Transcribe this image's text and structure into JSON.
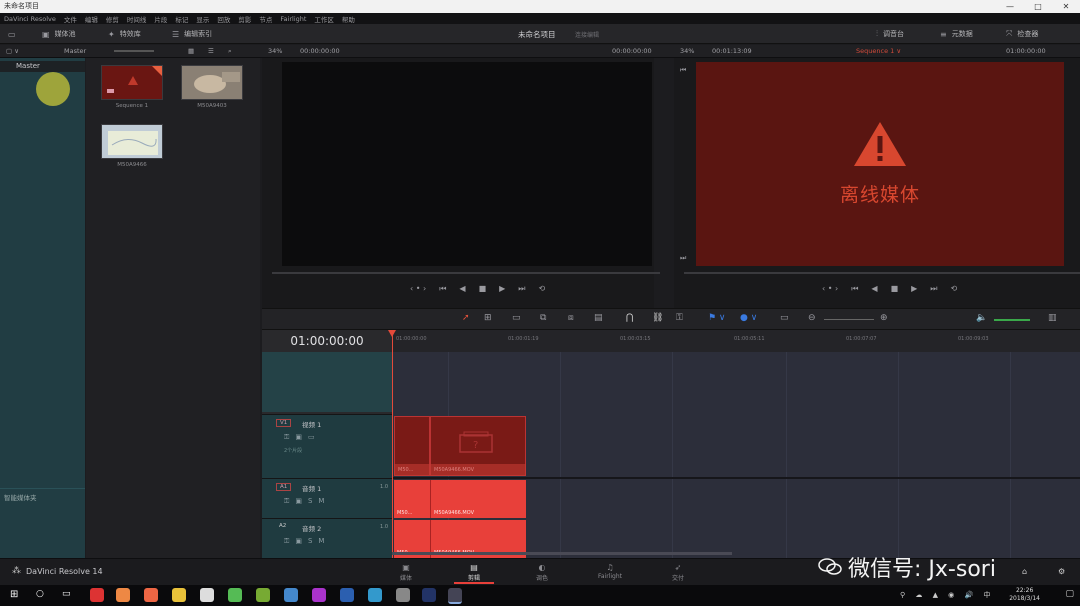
{
  "window": {
    "title": "未命名项目",
    "controls": [
      "—",
      "□",
      "✕"
    ]
  },
  "menu": [
    "DaVinci Resolve",
    "文件",
    "编辑",
    "修剪",
    "时间线",
    "片段",
    "标记",
    "显示",
    "回放",
    "剪影",
    "节点",
    "Fairlight",
    "工作区",
    "帮助"
  ],
  "toolbar": {
    "media_pool": "媒体池",
    "effects": "特效库",
    "edit_index": "编辑索引",
    "project_name": "未命名项目",
    "project_sub": "连接编辑",
    "mixer": "调音台",
    "metadata": "元数据",
    "inspector": "检查器"
  },
  "secbar": {
    "master": "Master",
    "src_zoom": "34%",
    "src_tc": "00:00:00:00",
    "src_dur": "00:00:00:00",
    "tl_zoom": "34%",
    "tl_tc": "00:01:13:09",
    "sequence": "Sequence 1 ∨",
    "tl_tc_right": "01:00:00:00"
  },
  "bins": {
    "master": "Master",
    "smart_bins": "智能媒体夹"
  },
  "clips": [
    {
      "name": "Sequence 1"
    },
    {
      "name": "M50A9403"
    },
    {
      "name": "M50A9466"
    }
  ],
  "viewer": {
    "offline": "离线媒体"
  },
  "timeline": {
    "timecode": "01:00:00:00",
    "ticks": [
      "01:00:00:00",
      "01:00:01:19",
      "01:00:03:15",
      "01:00:05:11",
      "01:00:07:07",
      "01:00:09:03"
    ],
    "tracks": [
      {
        "tag": "V1",
        "name": "视频 1",
        "sub": "2个片段"
      },
      {
        "tag": "A1",
        "name": "音频 1",
        "ch": "1.0"
      },
      {
        "tag": "A2",
        "name": "音频 2",
        "ch": "1.0"
      }
    ],
    "clip_short": "M50...",
    "clip_full": "M50A9466.MOV"
  },
  "pages": [
    {
      "icon": "▣",
      "label": "媒体"
    },
    {
      "icon": "▤",
      "label": "剪辑"
    },
    {
      "icon": "◐",
      "label": "调色"
    },
    {
      "icon": "♫",
      "label": "Fairlight"
    },
    {
      "icon": "➶",
      "label": "交付"
    }
  ],
  "brand": "DaVinci Resolve 14",
  "watermark": "微信号: Jx-sori",
  "clock": {
    "time": "22:26",
    "date": "2018/3/14"
  },
  "colors": {
    "offline_bg": "#5a1511",
    "clip_red": "#e8403a",
    "bins_teal": "#213d43"
  }
}
